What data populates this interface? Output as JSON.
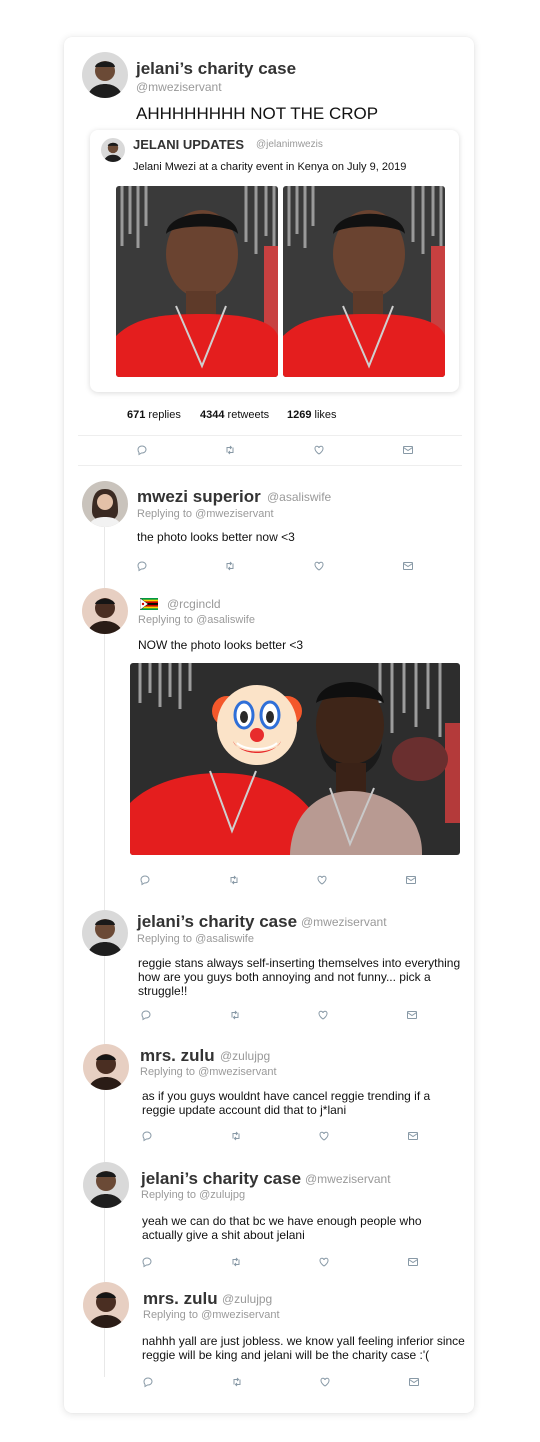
{
  "main_tweet": {
    "name": "jelani’s charity case",
    "handle": "@mweziservant",
    "text": "AHHHHHHHH NOT THE CROP",
    "quote": {
      "name": "JELANI UPDATES",
      "handle": "@jelanimwezis",
      "text": "Jelani Mwezi at a charity event in Kenya on July 9, 2019"
    },
    "stats": {
      "replies_count": "671",
      "replies_label": "replies",
      "retweets_count": "4344",
      "retweets_label": "retweets",
      "likes_count": "1269",
      "likes_label": "likes"
    }
  },
  "replies": [
    {
      "name": "mwezi superior",
      "handle": "@asaliswife",
      "replying": "Replying to @mweziservant",
      "text": "the photo looks better now <3"
    },
    {
      "name": "",
      "flag": "zimbabwe-flag",
      "handle": "@rcgincld",
      "replying": "Replying to @asaliswife",
      "text": "NOW the photo looks better <3"
    },
    {
      "name": "jelani’s charity case",
      "handle": "@mweziservant",
      "replying": "Replying to @asaliswife",
      "text": "reggie stans always self-inserting themselves into everything how are you guys both annoying and not funny... pick a struggle!!"
    },
    {
      "name": "mrs. zulu",
      "handle": "@zulujpg",
      "replying": "Replying to @mweziservant",
      "text": "as if you guys wouldnt have cancel reggie trending if a reggie update account did that to j*lani"
    },
    {
      "name": "jelani’s charity case",
      "handle": "@mweziservant",
      "replying": "Replying to @zulujpg",
      "text": "yeah we can do that bc we have enough people who actually give a shit about jelani"
    },
    {
      "name": "mrs. zulu",
      "handle": "@zulujpg",
      "replying": "Replying to @mweziservant",
      "text": "nahhh yall are just jobless. we know yall feeling inferior since reggie will be king and jelani will be the charity case :'("
    }
  ],
  "icons": {
    "reply": "reply-icon",
    "retweet": "retweet-icon",
    "like": "heart-icon",
    "dm": "mail-icon",
    "clown": "clown-emoji"
  },
  "colors": {
    "icon": "#8899a6",
    "shirt_red": "#e41e1e",
    "handle_gray": "#999999"
  }
}
